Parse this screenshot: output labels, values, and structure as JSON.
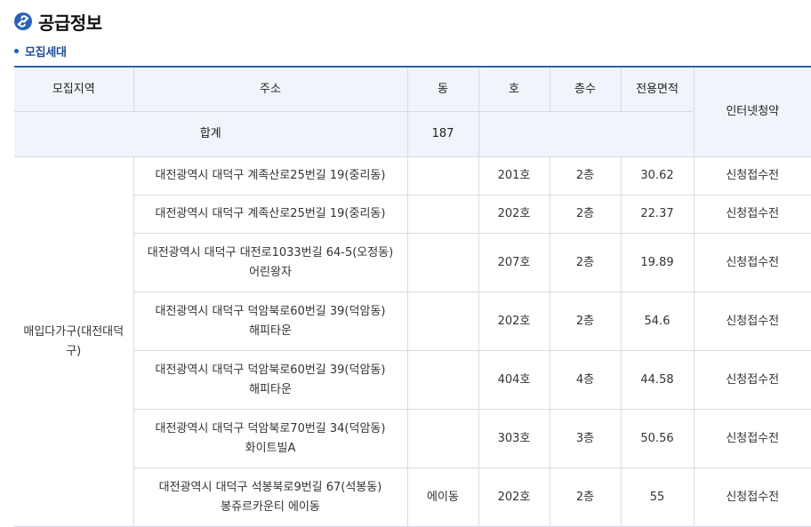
{
  "header": {
    "title": "공급정보",
    "subtitle": "모집세대",
    "accent_color": "#2a62b8"
  },
  "table": {
    "headers": {
      "region": "모집지역",
      "address": "주소",
      "dong": "동",
      "ho": "호",
      "floor": "층수",
      "area": "전용면적",
      "internet": "인터넷청약"
    },
    "summary": {
      "label": "합계",
      "count": "187"
    },
    "region_label": "매입다가구(대전대덕구)",
    "rows": [
      {
        "address": "대전광역시 대덕구 계족산로25번길 19(중리동)",
        "dong": "",
        "ho": "201호",
        "floor": "2층",
        "area": "30.62",
        "status": "신청접수전"
      },
      {
        "address": "대전광역시 대덕구 계족산로25번길 19(중리동)",
        "dong": "",
        "ho": "202호",
        "floor": "2층",
        "area": "22.37",
        "status": "신청접수전"
      },
      {
        "address": "대전광역시 대덕구 대전로1033번길 64-5(오정동) 어린왕자",
        "dong": "",
        "ho": "207호",
        "floor": "2층",
        "area": "19.89",
        "status": "신청접수전"
      },
      {
        "address": "대전광역시 대덕구 덕암북로60번길 39(덕암동) 해피타운",
        "dong": "",
        "ho": "202호",
        "floor": "2층",
        "area": "54.6",
        "status": "신청접수전"
      },
      {
        "address": "대전광역시 대덕구 덕암북로60번길 39(덕암동) 해피타운",
        "dong": "",
        "ho": "404호",
        "floor": "4층",
        "area": "44.58",
        "status": "신청접수전"
      },
      {
        "address": "대전광역시 대덕구 덕암북로70번길 34(덕암동) 화이트빌A",
        "dong": "",
        "ho": "303호",
        "floor": "3층",
        "area": "50.56",
        "status": "신청접수전"
      },
      {
        "address": "대전광역시 대덕구 석봉북로9번길 67(석봉동) 봉쥬르카운티 에이동",
        "dong": "에이동",
        "ho": "202호",
        "floor": "2층",
        "area": "55",
        "status": "신청접수전"
      }
    ]
  }
}
